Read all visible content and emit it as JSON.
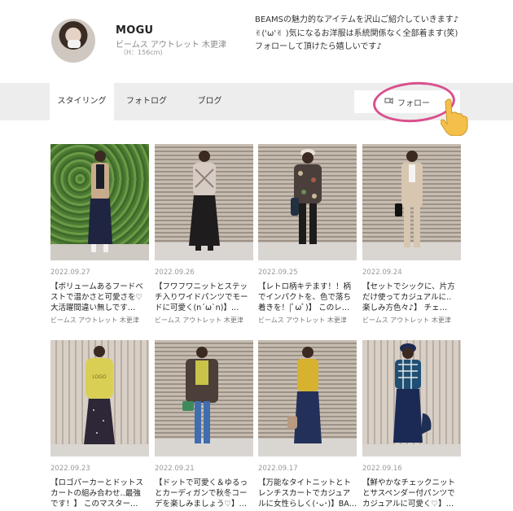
{
  "profile": {
    "name": "MOGU",
    "shop": "ビームス アウトレット 木更津",
    "height": "（H：156cm)",
    "bio": [
      "BEAMSの魅力的なアイテムを沢山ご紹介していきます♪",
      "✌('ω'✌ )気になるお洋服は系統関係なく全部着ます(笑)",
      "フォローして頂けたら嬉しいです♪"
    ]
  },
  "tabs": [
    {
      "label": "スタイリング",
      "active": true
    },
    {
      "label": "フォトログ",
      "active": false
    },
    {
      "label": "ブログ",
      "active": false
    }
  ],
  "follow": {
    "label": "フォロー",
    "icon": "follow-icon"
  },
  "posts": [
    {
      "date": "2022.09.27",
      "title": [
        "【ボリュームあるフードベ",
        "ストで温かさと可愛さを♡",
        "大活躍間違い無しです…"
      ],
      "shop": "ビームス アウトレット 木更津"
    },
    {
      "date": "2022.09.26",
      "title": [
        "【フワフワニットとステッ",
        "チ入りワイドパンツでモー",
        "ドに可愛く(n´ω`n)】…"
      ],
      "shop": "ビームス アウトレット 木更津"
    },
    {
      "date": "2022.09.25",
      "title": [
        "【レトロ柄キテます！！柄",
        "でインパクトを、色で落ち",
        "着きを！|ﾟωﾟ)】 このレ…"
      ],
      "shop": "ビームス アウトレット 木更津"
    },
    {
      "date": "2022.09.24",
      "title": [
        "【セットでシックに、片方",
        "だけ使ってカジュアルに‥",
        "楽しみ方色々♪】 チェ…"
      ],
      "shop": "ビームス アウトレット 木更津"
    },
    {
      "date": "2022.09.23",
      "title": [
        "【ロゴパーカーとドットス",
        "カートの組み合わせ‥最強",
        "です！】 このマスター…"
      ],
      "shop": ""
    },
    {
      "date": "2022.09.21",
      "title": [
        "【ドットで可愛く＆ゆるっ",
        "とカーディガンで秋冬コー",
        "デを楽しみましょう♡】…"
      ],
      "shop": ""
    },
    {
      "date": "2022.09.17",
      "title": [
        "【万能なタイトニットとト",
        "レンチスカートでカジュア",
        "ルに女性らしく(･ᴗ･)】BA…"
      ],
      "shop": ""
    },
    {
      "date": "2022.09.16",
      "title": [
        "【鮮やかなチェックニット",
        "とサスペンダー付パンツで",
        "カジュアルに可愛く♡】…"
      ],
      "shop": ""
    }
  ],
  "colors": {
    "annotation": "#d9508d",
    "navbar": "#ededed",
    "hand": "#f4c04a"
  }
}
